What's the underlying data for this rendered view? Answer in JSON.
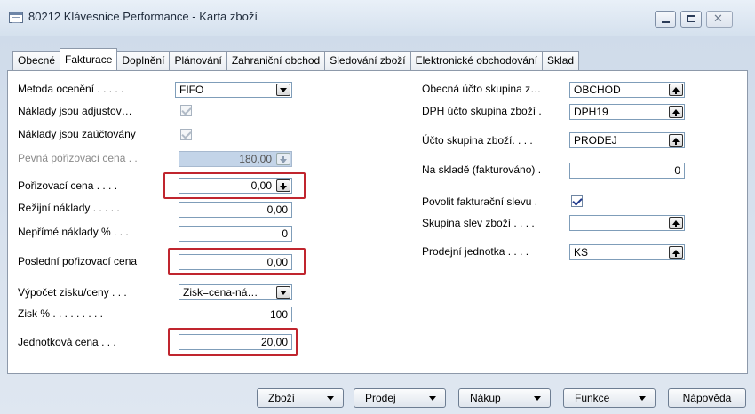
{
  "window": {
    "title": "80212 Klávesnice Performance - Karta zboží",
    "close_glyph": "✕"
  },
  "tabs": [
    {
      "label": "Obecné"
    },
    {
      "label": "Fakturace"
    },
    {
      "label": "Doplnění"
    },
    {
      "label": "Plánování"
    },
    {
      "label": "Zahraniční obchod"
    },
    {
      "label": "Sledování zboží"
    },
    {
      "label": "Elektronické obchodování"
    },
    {
      "label": "Sklad"
    }
  ],
  "active_tab": "Fakturace",
  "left": {
    "metoda_oceneni": {
      "label": "Metoda ocenění . . . . .",
      "value": "FIFO"
    },
    "naklady_adjustov": {
      "label": "Náklady jsou adjustov…",
      "checked": true
    },
    "naklady_zauctovany": {
      "label": "Náklady jsou zaúčtovány",
      "checked": true
    },
    "pevna_cena": {
      "label": "Pevná pořizovací cena . .",
      "value": "180,00"
    },
    "porizovaci_cena": {
      "label": "Pořizovací cena . . . .",
      "value": "0,00"
    },
    "rezijni_naklady": {
      "label": "Režijní náklady . . . . .",
      "value": "0,00"
    },
    "neprime_naklady": {
      "label": "Nepřímé náklady % . . .",
      "value": "0"
    },
    "posledni_cena": {
      "label": "Poslední pořizovací cena",
      "value": "0,00"
    },
    "vypocet_zisku": {
      "label": "Výpočet zisku/ceny . . .",
      "value": "Zisk=cena-ná…"
    },
    "zisk": {
      "label": "Zisk % . . . . . . . . .",
      "value": "100"
    },
    "jednotkova_cena": {
      "label": "Jednotková cena . . .",
      "value": "20,00"
    }
  },
  "right": {
    "obecna_skupina": {
      "label": "Obecná účto skupina z…",
      "value": "OBCHOD"
    },
    "dph_skupina": {
      "label": "DPH účto skupina zboží .",
      "value": "DPH19"
    },
    "ucto_skupina": {
      "label": "Účto skupina zboží. . . .",
      "value": "PRODEJ"
    },
    "na_sklade": {
      "label": "Na skladě (fakturováno) .",
      "value": "0"
    },
    "povolit_slevu": {
      "label": "Povolit fakturační slevu .",
      "checked": true
    },
    "skupina_slev": {
      "label": "Skupina slev zboží . . . .",
      "value": ""
    },
    "prodejni_jednotka": {
      "label": "Prodejní jednotka . . . .",
      "value": "KS"
    }
  },
  "buttons": {
    "zbozi": "Zboží",
    "prodej": "Prodej",
    "nakup": "Nákup",
    "funkce": "Funkce",
    "napoveda": "Nápověda"
  },
  "colors": {
    "highlight": "#c0252e",
    "disabled_field": "#c3d4e8"
  }
}
